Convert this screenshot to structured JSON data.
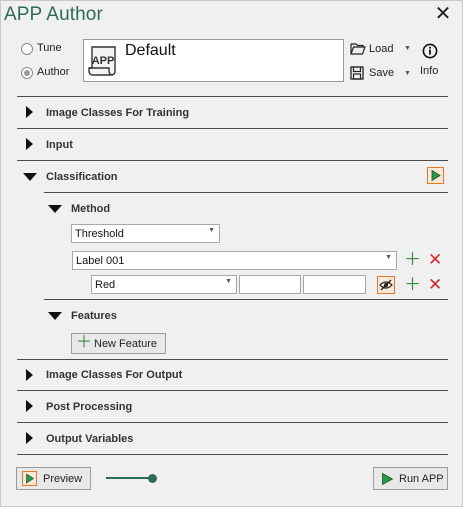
{
  "window": {
    "title": "APP Author",
    "close_glyph": "✕"
  },
  "mode": {
    "options": [
      {
        "label": "Tune",
        "selected": false
      },
      {
        "label": "Author",
        "selected": true
      }
    ]
  },
  "app": {
    "icon_text": "APP",
    "name": "Default"
  },
  "file_actions": {
    "load_label": "Load",
    "save_label": "Save",
    "info_label": "Info"
  },
  "sections": {
    "image_classes_training": "Image Classes For Training",
    "input": "Input",
    "classification": "Classification",
    "image_classes_output": "Image Classes For Output",
    "post_processing": "Post Processing",
    "output_variables": "Output Variables"
  },
  "method": {
    "label": "Method",
    "selected": "Threshold"
  },
  "label_row": {
    "selected": "Label 001"
  },
  "color_row": {
    "selected": "Red",
    "min_value": "",
    "max_value": ""
  },
  "features": {
    "label": "Features",
    "new_feature_label": "New Feature"
  },
  "footer": {
    "preview_label": "Preview",
    "run_label": "Run APP",
    "slider_value": 1.0
  },
  "colors": {
    "accent": "#2e6b57",
    "add": "#3a8a3a",
    "remove": "#d42a2a",
    "play": "#2a9a4a"
  }
}
